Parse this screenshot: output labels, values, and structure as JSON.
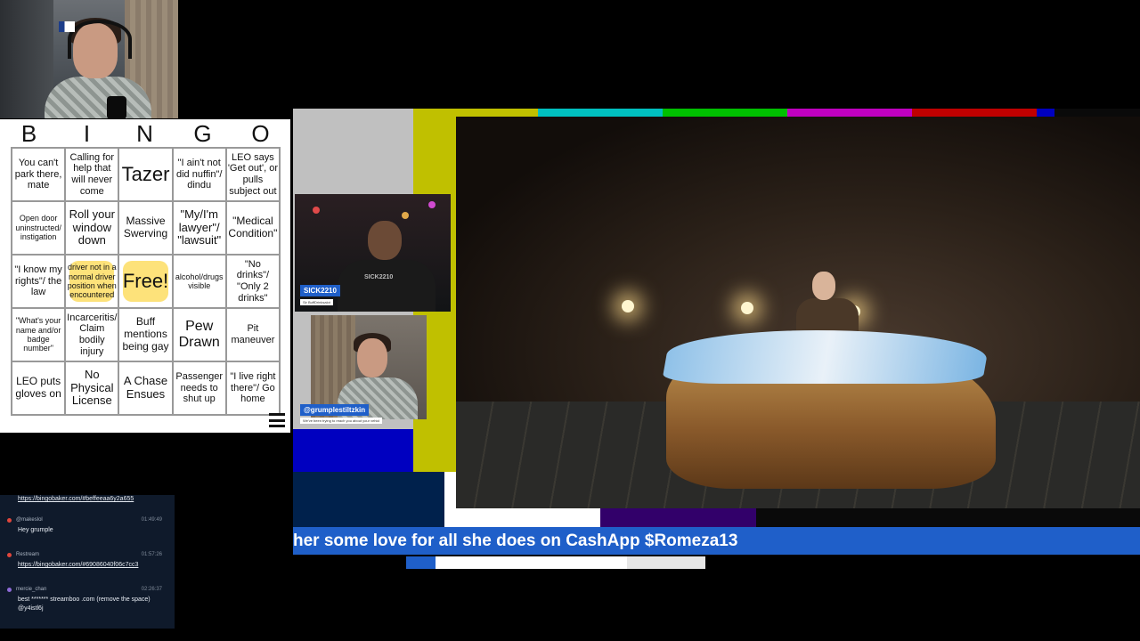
{
  "bingo": {
    "letters": [
      "B",
      "I",
      "N",
      "G",
      "O"
    ],
    "cells": [
      [
        "You can't park there, mate",
        "Calling for help that will never come",
        "Tazer",
        "\"I ain't not did nuffin\"/ dindu",
        "LEO says 'Get out', or pulls subject out"
      ],
      [
        "Open door uninstructed/ instigation",
        "Roll your window down",
        "Massive Swerving",
        "\"My/I'm lawyer\"/ \"lawsuit\"",
        "\"Medical Condition\""
      ],
      [
        "\"I know my rights\"/ the law",
        "driver not in a normal driver position when encountered",
        "Free!",
        "alcohol/drugs visible",
        "\"No drinks\"/ \"Only 2 drinks\""
      ],
      [
        "\"What's your name and/or badge number\"",
        "Incarceritis/ Claim bodily injury",
        "Buff mentions being gay",
        "Pew Drawn",
        "Pit maneuver"
      ],
      [
        "LEO puts gloves on",
        "No Physical License",
        "A Chase Ensues",
        "Passenger needs to shut up",
        "\"I live right there\"/ Go home"
      ]
    ]
  },
  "chat": {
    "messages": [
      {
        "user": "",
        "time": "",
        "text": "https://bingobaker.com/#beffeeaa6y2a655",
        "link": true,
        "color": "#1f5fc9"
      },
      {
        "user": "@makeslol",
        "time": "01:49:49",
        "text": "Hey grumple",
        "link": false,
        "color": "#e0463c"
      },
      {
        "user": "Restream",
        "time": "01:57:26",
        "text": "https://bingobaker.com/#69086040f06c7cc3",
        "link": true,
        "color": "#e0463c"
      },
      {
        "user": "mercie_chan",
        "time": "02:26:37",
        "text": "best ******* streamboo .com (remove the space) @y4istl6j",
        "link": false,
        "color": "#8e6bd8"
      }
    ]
  },
  "scene": {
    "guest_name": "SICK2210",
    "guest_sub": "Sir BuffDrinksalot",
    "host_name": "@grumplestiltzkin",
    "host_sub": "We've been trying to reach you about your vehicl",
    "guest_shirt": "SICK2210",
    "ticker": "her some love for all she does on CashApp $Romeza13"
  },
  "colors": {
    "accent_blue": "#1f5fc9",
    "bingo_highlight": "#fde27a",
    "chat_bg": "#0f1a2b"
  }
}
